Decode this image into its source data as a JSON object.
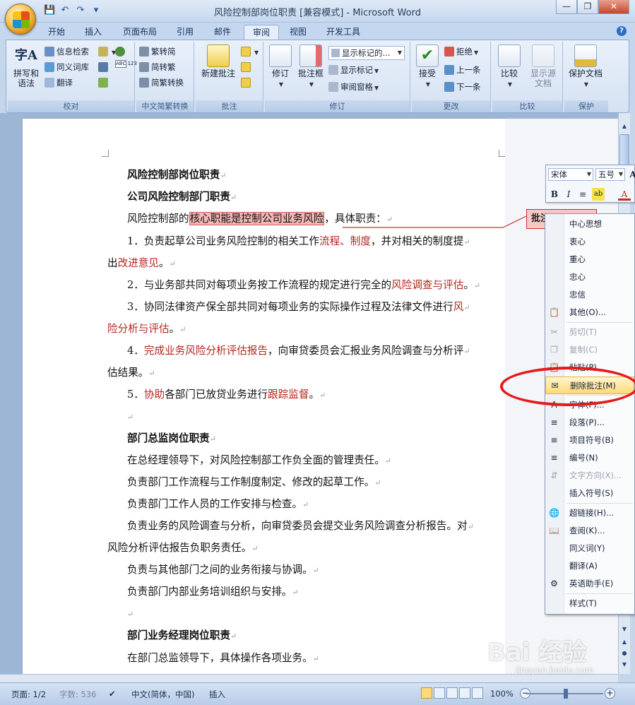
{
  "window": {
    "title": "风险控制部岗位职责 [兼容模式] - Microsoft Word"
  },
  "tabs": [
    "开始",
    "插入",
    "页面布局",
    "引用",
    "邮件",
    "审阅",
    "视图",
    "开发工具"
  ],
  "ribbon": {
    "proofing": {
      "label": "校对",
      "spelling": "拼写和语法",
      "research": "信息检索",
      "thesaurus": "同义词库",
      "translate": "翻译",
      "wordcount_icon": "ABC 123"
    },
    "chinese": {
      "label": "中文简繁转换",
      "to_simplified": "繁转简",
      "to_traditional": "简转繁",
      "convert": "简繁转换"
    },
    "comments": {
      "label": "批注",
      "new_comment": "新建批注"
    },
    "tracking": {
      "label": "修订",
      "track": "修订",
      "balloons": "批注框",
      "display_for_review": "显示标记的...",
      "show_markup": "显示标记",
      "reviewing_pane": "审阅窗格"
    },
    "changes": {
      "label": "更改",
      "accept": "接受",
      "reject": "拒绝",
      "previous": "上一条",
      "next": "下一条"
    },
    "compare": {
      "label": "比较",
      "compare": "比较",
      "show_source": "显示源文档"
    },
    "protect": {
      "label": "保护",
      "protect_doc": "保护文档"
    }
  },
  "document": {
    "lines": [
      {
        "text": "风险控制部岗位职责",
        "bold": true
      },
      {
        "text": "公司风险控制部门职责",
        "bold": true
      },
      {
        "pre": "风险控制部的",
        "hl": "核心职能是控制公司业务风险",
        "post": "，具体职责："
      },
      {
        "pre": "1．负责起草公司业务风险控制的相关工作",
        "red": "流程、制度",
        "post": "，并对相关的制度提"
      },
      {
        "pre": "出",
        "red": "改进意见",
        "post": "。"
      },
      {
        "pre": "2．与业务部共同对每项业务按工作流程的规定进行完全的",
        "red": "风险调查与评估",
        "post": "。"
      },
      {
        "pre": "3．协同法律资产保全部共同对每项业务的实际操作过程及法律文件进行",
        "red": "风",
        "post": ""
      },
      {
        "pre": "",
        "red": "险分析与评估",
        "post": "。"
      },
      {
        "pre": "4．",
        "red": "完成业务风险分析评估报告",
        "post": "，向审贷委员会汇报业务风险调查与分析评"
      },
      {
        "pre": "估结果。",
        "red": "",
        "post": ""
      },
      {
        "pre": "5．",
        "red": "协助",
        "post": "各部门已放贷业务进行",
        "red2": "跟踪监督",
        "post2": "。"
      },
      {
        "text": "",
        "bold": false
      },
      {
        "text": "部门总监岗位职责",
        "bold": true
      },
      {
        "text": "在总经理领导下，对风险控制部工作负全面的管理责任。",
        "bold": false
      },
      {
        "text": "负责部门工作流程与工作制度制定、修改的起草工作。",
        "bold": false
      },
      {
        "text": "负责部门工作人员的工作安排与检查。",
        "bold": false
      },
      {
        "text": "负责业务的风险调查与分析，向审贷委员会提交业务风险调查分析报告。对",
        "bold": false
      },
      {
        "text": "风险分析评估报告负职务责任。",
        "bold": false
      },
      {
        "text": "负责与其他部门之间的业务衔接与协调。",
        "bold": false
      },
      {
        "text": "负责部门内部业务培训组织与安排。",
        "bold": false
      },
      {
        "text": "",
        "bold": false
      },
      {
        "text": "部门业务经理岗位职责",
        "bold": true
      },
      {
        "text": "在部门总监领导下，具体操作各项业务。",
        "bold": false
      }
    ],
    "comment_balloon": "批注"
  },
  "mini_toolbar": {
    "font": "宋体",
    "size": "五号"
  },
  "context_menu": {
    "items": [
      {
        "label": "中心思想",
        "disabled": false
      },
      {
        "label": "衷心",
        "disabled": false
      },
      {
        "label": "重心",
        "disabled": false
      },
      {
        "label": "忠心",
        "disabled": false
      },
      {
        "label": "忠信",
        "disabled": false
      },
      {
        "label": "其他(O)...",
        "disabled": false
      },
      {
        "label": "剪切(T)",
        "disabled": true
      },
      {
        "label": "复制(C)",
        "disabled": true
      },
      {
        "label": "粘贴(P)",
        "disabled": false
      },
      {
        "label": "删除批注(M)",
        "disabled": false,
        "selected": true
      },
      {
        "label": "字体(F)...",
        "disabled": false
      },
      {
        "label": "段落(P)...",
        "disabled": false
      },
      {
        "label": "项目符号(B)",
        "disabled": false
      },
      {
        "label": "编号(N)",
        "disabled": false
      },
      {
        "label": "文字方向(X)...",
        "disabled": true
      },
      {
        "label": "插入符号(S)",
        "disabled": false
      },
      {
        "label": "超链接(H)...",
        "disabled": false
      },
      {
        "label": "查阅(K)...",
        "disabled": false
      },
      {
        "label": "同义词(Y)",
        "disabled": false
      },
      {
        "label": "翻译(A)",
        "disabled": false
      },
      {
        "label": "英语助手(E)",
        "disabled": false
      },
      {
        "label": "样式(T)",
        "disabled": false
      }
    ]
  },
  "statusbar": {
    "page": "页面: 1/2",
    "words": "字数: 536",
    "language": "中文(简体，中国)",
    "insert": "插入",
    "zoom": "100%"
  },
  "watermark": {
    "brand": "Bai 经验",
    "url": "jingyan.baidu.com"
  },
  "colors": {
    "accent_red": "#b3261e",
    "comment_fill": "#f6b6b6",
    "ellipse": "#e21b1b"
  }
}
